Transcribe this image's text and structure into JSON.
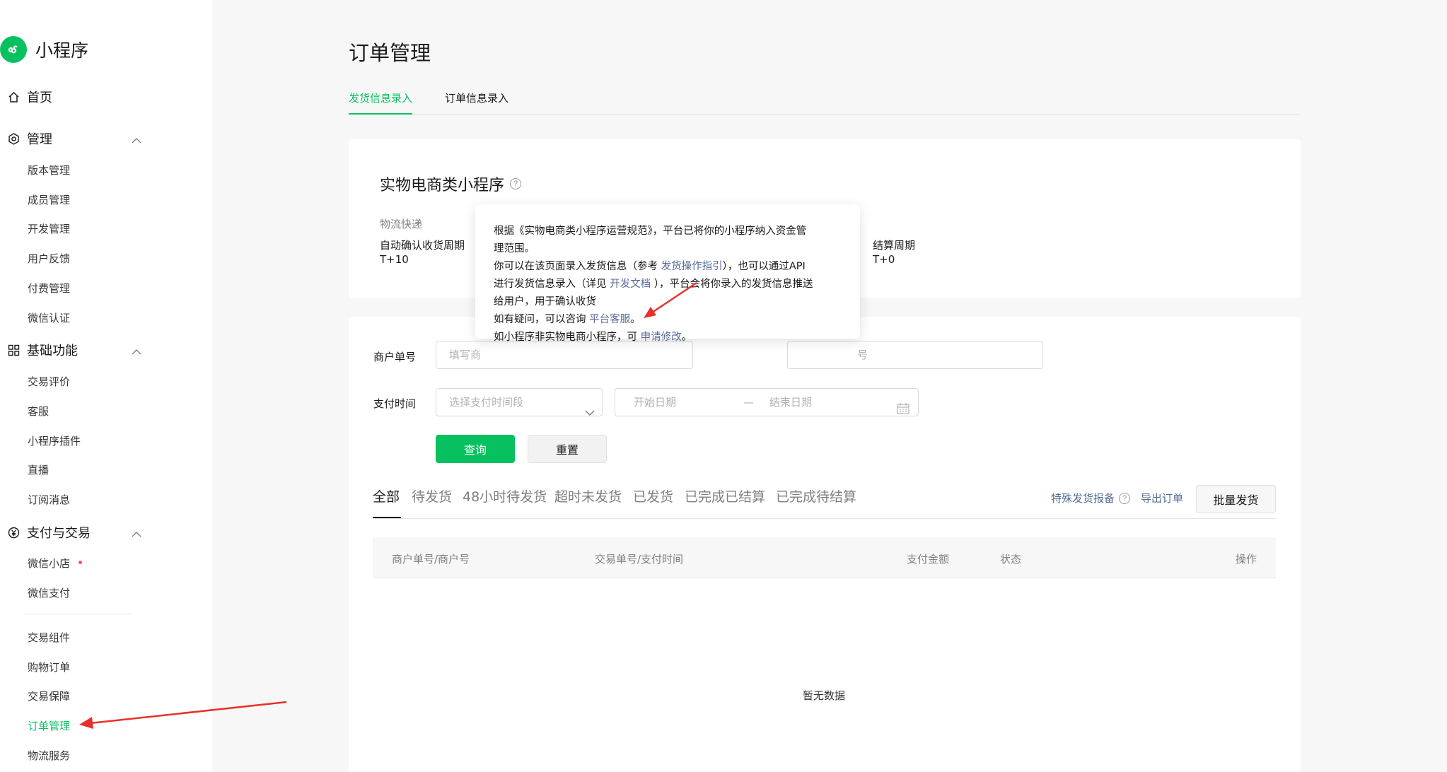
{
  "app": {
    "name": "小程序",
    "accent": "#07c160"
  },
  "sidebar": {
    "home": {
      "label": "首页",
      "icon": "home-icon"
    },
    "manage": {
      "label": "管理",
      "icon": "gear-icon",
      "items": [
        "版本管理",
        "成员管理",
        "开发管理",
        "用户反馈",
        "付费管理",
        "微信认证"
      ]
    },
    "basic": {
      "label": "基础功能",
      "icon": "grid-icon",
      "items": [
        "交易评价",
        "客服",
        "小程序插件",
        "直播",
        "订阅消息"
      ]
    },
    "payment": {
      "label": "支付与交易",
      "icon": "yuan-icon",
      "items": [
        "微信小店",
        "微信支付"
      ],
      "more_items": [
        "交易组件",
        "购物订单",
        "交易保障",
        "订单管理",
        "物流服务"
      ],
      "active_item": "订单管理"
    }
  },
  "page": {
    "title": "订单管理",
    "tabs": [
      {
        "label": "发货信息录入",
        "active": true
      },
      {
        "label": "订单信息录入",
        "active": false
      }
    ]
  },
  "info": {
    "title": "实物电商类小程序",
    "help": "?",
    "category_label": "物流快递",
    "confirm_label": "自动确认收货周期",
    "confirm_value": "T+10",
    "settle_label": "结算周期",
    "settle_value": "T+0"
  },
  "popover": {
    "line1": "根据《实物电商类小程序运营规范》，平台已将你的小程序纳入资金管",
    "line2": "理范围。",
    "line3_a": "你可以在该页面录入发货信息（参考 ",
    "line3_link": "发货操作指引",
    "line3_b": "），也可以通过API",
    "line4_a": "进行发货信息录入（详见 ",
    "line4_link": "开发文档",
    "line4_b": " ），平台会将你录入的发货信息推送",
    "line5": "给用户，用于确认收货",
    "line6_a": "如有疑问，可以咨询 ",
    "line6_link": "平台客服",
    "line6_b": "。",
    "line7_a": "如小程序非实物电商小程序，可 ",
    "line7_link": "申请修改",
    "line7_b": "。"
  },
  "search": {
    "merchant_label": "商户单号",
    "merchant_placeholder": "填写商",
    "second_placeholder": "号",
    "pay_time_label": "支付时间",
    "pay_time_placeholder": "选择支付时间段",
    "start_date": "开始日期",
    "date_sep": "—",
    "end_date": "结束日期",
    "query": "查询",
    "reset": "重置"
  },
  "status_tabs": [
    "全部",
    "待发货",
    "48小时待发货",
    "超时未发货",
    "已发货",
    "已完成已结算",
    "已完成待结算"
  ],
  "actions": {
    "special": "特殊发货报备",
    "export": "导出订单",
    "batch": "批量发货"
  },
  "table": {
    "columns": [
      "商户单号/商户号",
      "交易单号/支付时间",
      "支付金额",
      "状态",
      "操作"
    ],
    "empty": "暂无数据"
  },
  "annotation_color": "#e8302a"
}
